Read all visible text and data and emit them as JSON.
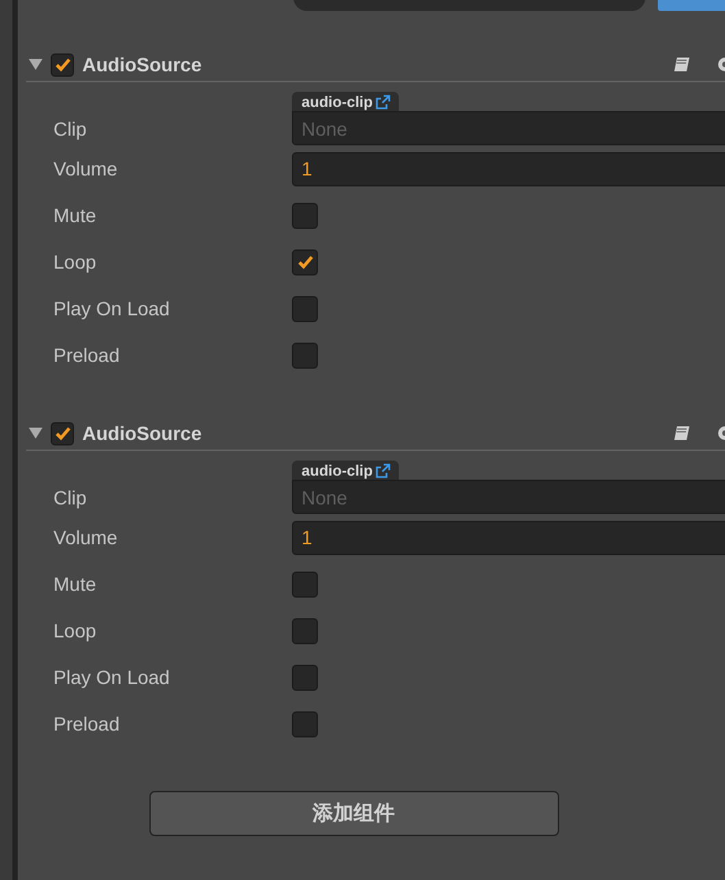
{
  "components": [
    {
      "title": "AudioSource",
      "expanded": true,
      "enabled": true,
      "properties": [
        {
          "kind": "asset",
          "label": "Clip",
          "tag": "audio-clip",
          "placeholder": "None"
        },
        {
          "kind": "number",
          "label": "Volume",
          "value": "1"
        },
        {
          "kind": "checkbox",
          "label": "Mute",
          "checked": false
        },
        {
          "kind": "checkbox",
          "label": "Loop",
          "checked": true
        },
        {
          "kind": "checkbox",
          "label": "Play On Load",
          "checked": false
        },
        {
          "kind": "checkbox",
          "label": "Preload",
          "checked": false
        }
      ]
    },
    {
      "title": "AudioSource",
      "expanded": true,
      "enabled": true,
      "properties": [
        {
          "kind": "asset",
          "label": "Clip",
          "tag": "audio-clip",
          "placeholder": "None"
        },
        {
          "kind": "number",
          "label": "Volume",
          "value": "1"
        },
        {
          "kind": "checkbox",
          "label": "Mute",
          "checked": false
        },
        {
          "kind": "checkbox",
          "label": "Loop",
          "checked": false
        },
        {
          "kind": "checkbox",
          "label": "Play On Load",
          "checked": false
        },
        {
          "kind": "checkbox",
          "label": "Preload",
          "checked": false
        }
      ]
    }
  ],
  "add_button": "添加组件"
}
